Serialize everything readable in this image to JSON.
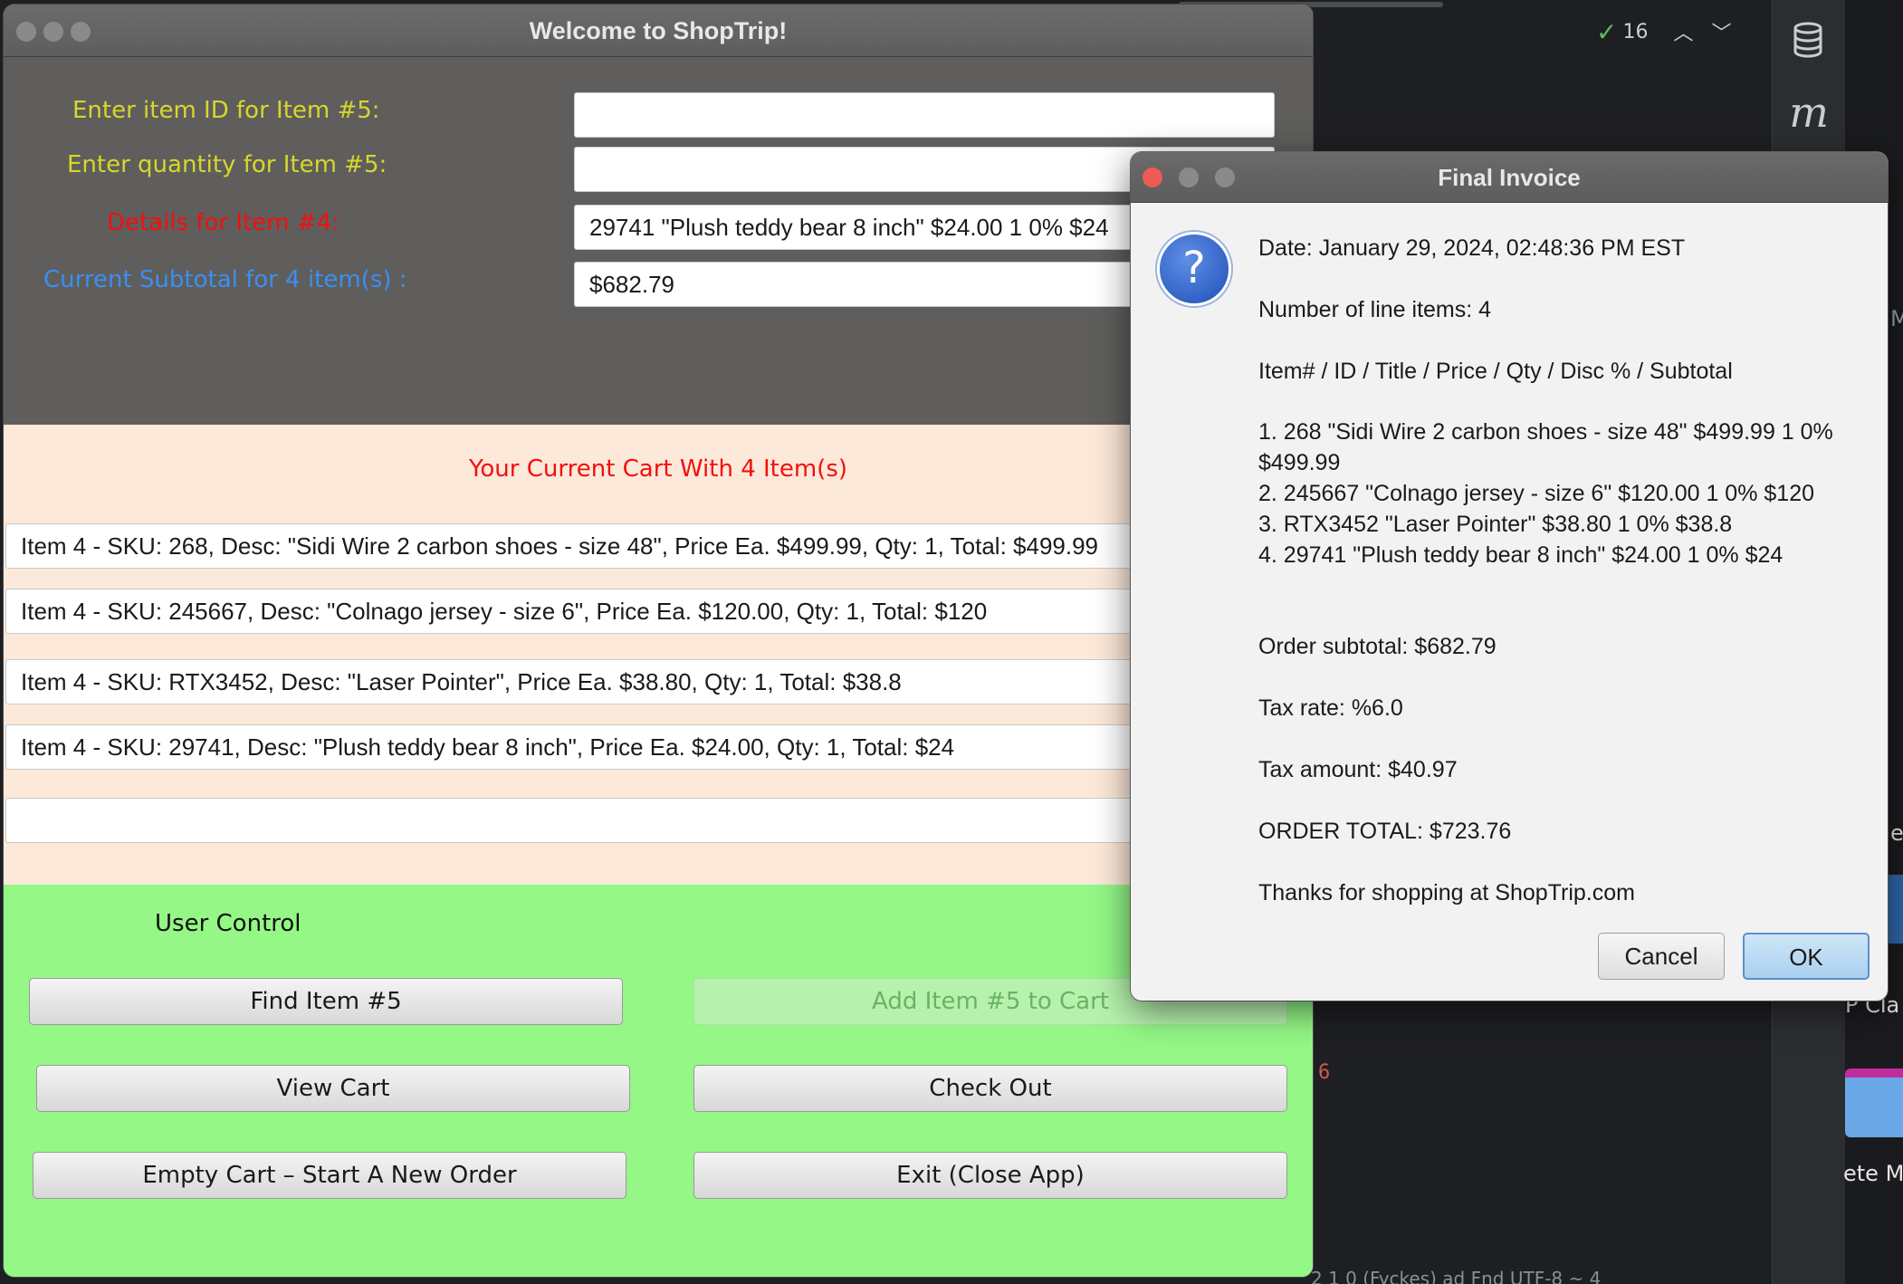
{
  "ide": {
    "inspection_count": "16",
    "maven_glyph": "m",
    "gutter_number": "6",
    "status_text": "2 1 0 (Fyckes) ad Fnd UTF-8 ~ 4",
    "cropped_right_texts": [
      "M",
      "er",
      "P Cla",
      "ete M"
    ]
  },
  "main_window": {
    "title": "Welcome to ShopTrip!",
    "input_panel": {
      "item_id_label": "Enter item ID for Item #5:",
      "item_id_value": "",
      "quantity_label": "Enter quantity for Item #5:",
      "quantity_value": "",
      "details_label": "Details for Item #4:",
      "details_value": "29741 \"Plush teddy bear 8 inch\" $24.00 1 0% $24",
      "subtotal_label": "Current Subtotal for 4 item(s) :",
      "subtotal_value": "$682.79"
    },
    "cart": {
      "title": "Your Current Cart With 4 Item(s)",
      "lines": [
        "Item 4 - SKU: 268, Desc: \"Sidi Wire 2 carbon shoes - size 48\", Price Ea. $499.99, Qty: 1, Total: $499.99",
        "Item 4 - SKU: 245667, Desc: \"Colnago jersey - size 6\", Price Ea. $120.00, Qty: 1, Total: $120",
        "Item 4 - SKU: RTX3452, Desc: \"Laser Pointer\", Price Ea. $38.80, Qty: 1, Total: $38.8",
        "Item 4 - SKU: 29741, Desc: \"Plush teddy bear 8 inch\", Price Ea. $24.00, Qty: 1, Total: $24",
        ""
      ]
    },
    "controls": {
      "label": "User Control",
      "find_item": "Find Item #5",
      "add_item": "Add Item #5 to Cart",
      "view_cart": "View Cart",
      "check_out": "Check Out",
      "empty_cart": "Empty Cart – Start A New Order",
      "exit": "Exit (Close App)"
    },
    "colors": {
      "input_panel_bg": "#5f5e5c",
      "cart_panel_bg": "#fde9d9",
      "control_panel_bg": "#94f786",
      "label_yellow": "#d6d72c",
      "label_red": "#f30f0f",
      "label_blue": "#3b8ff0"
    }
  },
  "dialog": {
    "title": "Final Invoice",
    "icon": "question-icon",
    "date": "Date: January 29, 2024, 02:48:36 PM EST",
    "line_count": "Number of line items: 4",
    "header": "Item# / ID / Title / Price / Qty / Disc % / Subtotal",
    "items": [
      "1. 268 \"Sidi Wire 2 carbon shoes - size 48\" $499.99 1 0%",
      "$499.99",
      "2. 245667 \"Colnago jersey - size 6\" $120.00 1 0% $120",
      "3. RTX3452 \"Laser Pointer\" $38.80 1 0% $38.8",
      "4. 29741 \"Plush teddy bear 8 inch\" $24.00 1 0% $24"
    ],
    "order_subtotal": "Order subtotal: $682.79",
    "tax_rate": "Tax rate: %6.0",
    "tax_amount": "Tax amount: $40.97",
    "order_total": "ORDER TOTAL: $723.76",
    "thanks": "Thanks for shopping at ShopTrip.com",
    "cancel_label": "Cancel",
    "ok_label": "OK"
  }
}
